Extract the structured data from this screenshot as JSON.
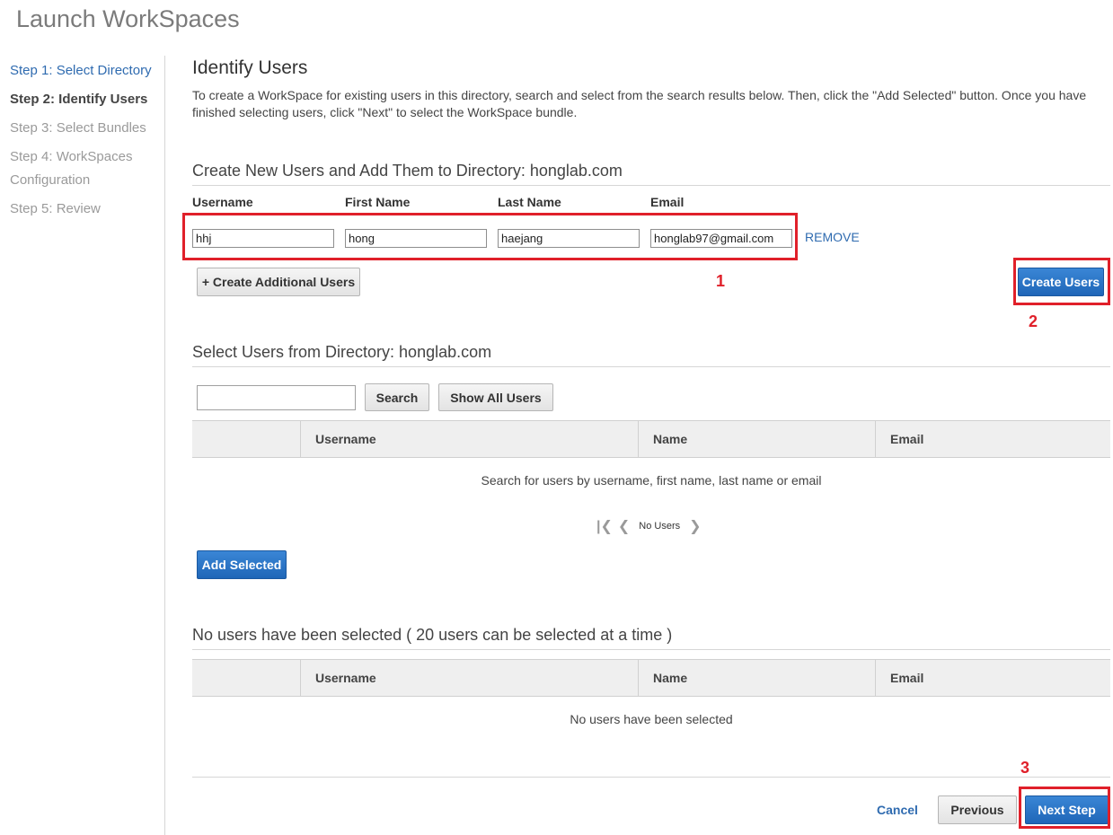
{
  "page": {
    "title": "Launch WorkSpaces"
  },
  "sidebar": {
    "steps": [
      {
        "label": "Step 1: Select Directory"
      },
      {
        "label": "Step 2: Identify Users"
      },
      {
        "label": "Step 3: Select Bundles"
      },
      {
        "label": "Step 4: WorkSpaces Configuration"
      },
      {
        "label": "Step 5: Review"
      }
    ]
  },
  "main": {
    "title": "Identify Users",
    "intro": "To create a WorkSpace for existing users in this directory, search and select from the search results below. Then, click the \"Add Selected\" button. Once you have finished selecting users, click \"Next\" to select the WorkSpace bundle."
  },
  "create_section": {
    "heading": "Create New Users and Add Them to Directory: honglab.com",
    "columns": [
      "Username",
      "First Name",
      "Last Name",
      "Email"
    ],
    "row": {
      "username": "hhj",
      "first_name": "hong",
      "last_name": "haejang",
      "email": "honglab97@gmail.com"
    },
    "remove_label": "REMOVE",
    "add_more_label": "+ Create Additional Users",
    "create_label": "Create Users"
  },
  "select_section": {
    "heading": "Select Users from Directory: honglab.com",
    "search_value": "",
    "search_label": "Search",
    "show_all_label": "Show All Users",
    "columns": [
      "Username",
      "Name",
      "Email"
    ],
    "empty_message": "Search for users by username, first name, last name or email",
    "pager_label": "No Users",
    "add_selected_label": "Add Selected"
  },
  "selected_section": {
    "heading": "No users have been selected ( 20 users can be selected at a time )",
    "columns": [
      "Username",
      "Name",
      "Email"
    ],
    "empty_message": "No users have been selected"
  },
  "footer": {
    "cancel_label": "Cancel",
    "previous_label": "Previous",
    "next_label": "Next Step"
  },
  "annotations": {
    "one": "1",
    "two": "2",
    "three": "3"
  },
  "colors": {
    "link": "#2f6bb0",
    "primary": "#1f66b8",
    "annotation": "#e0202a"
  }
}
